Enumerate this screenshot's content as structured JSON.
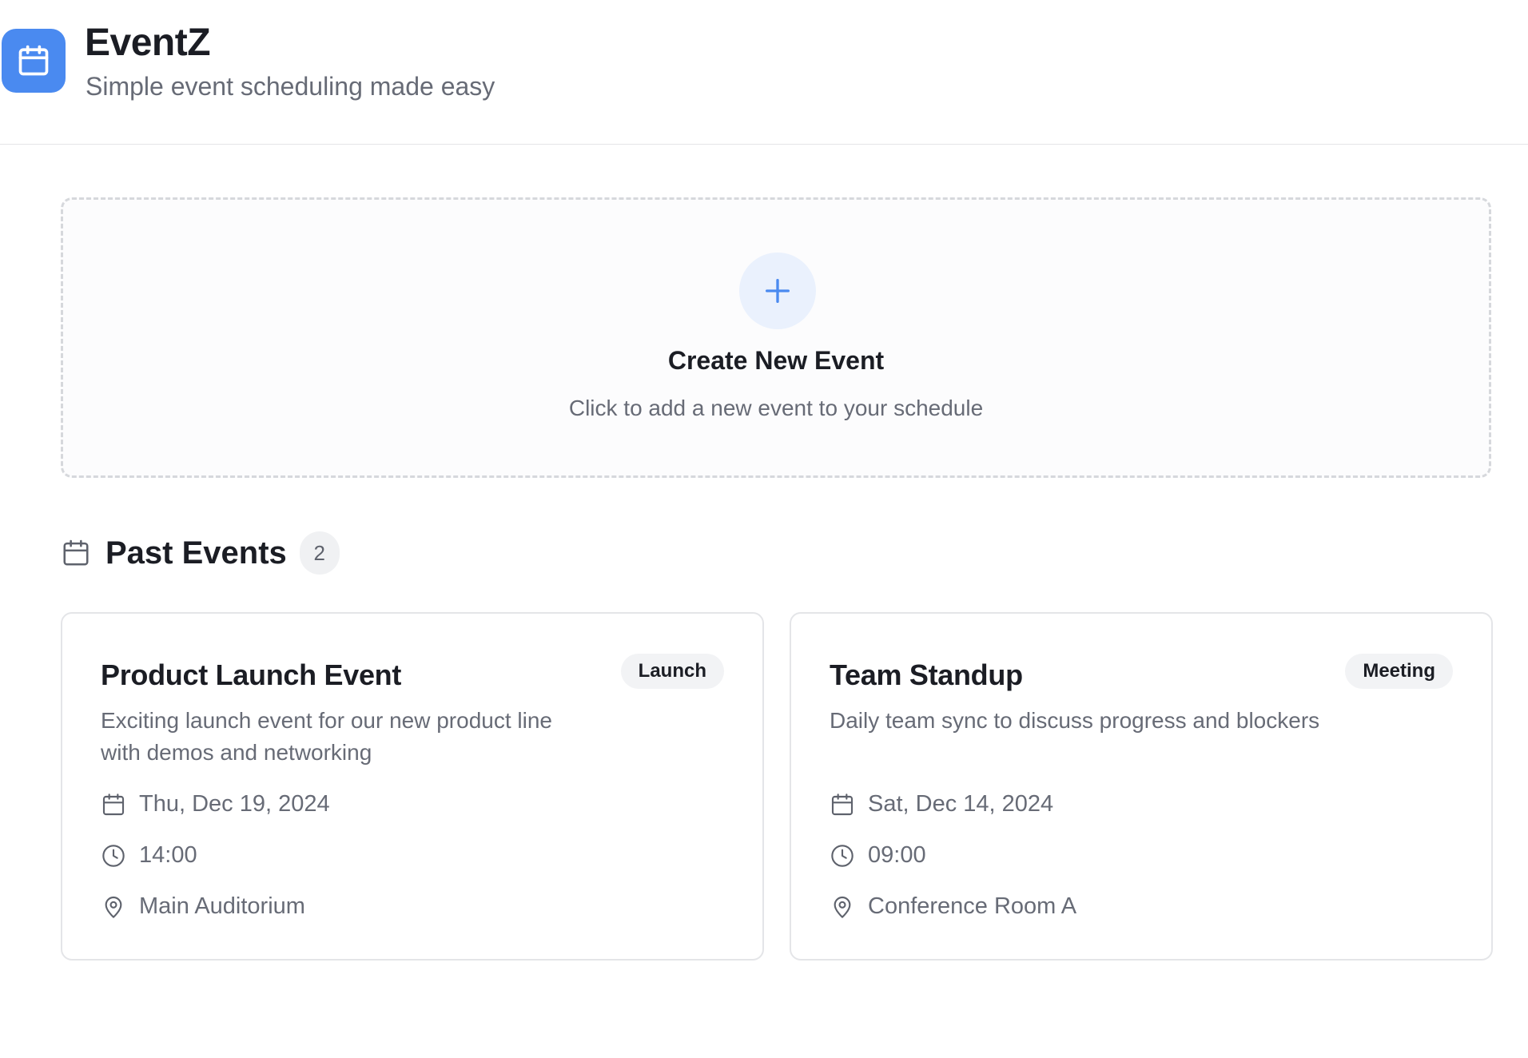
{
  "app": {
    "title": "EventZ",
    "subtitle": "Simple event scheduling made easy",
    "logo_icon": "calendar-icon",
    "accent_color": "#4a8af0"
  },
  "create": {
    "title": "Create New Event",
    "description": "Click to add a new event to your schedule",
    "icon": "plus-icon"
  },
  "past_events": {
    "title": "Past Events",
    "count": "2",
    "icon": "calendar-icon",
    "events": [
      {
        "title": "Product Launch Event",
        "tag": "Launch",
        "description": "Exciting launch event for our new product line with demos and networking",
        "date": "Thu, Dec 19, 2024",
        "time": "14:00",
        "location": "Main Auditorium"
      },
      {
        "title": "Team Standup",
        "tag": "Meeting",
        "description": "Daily team sync to discuss progress and blockers",
        "date": "Sat, Dec 14, 2024",
        "time": "09:00",
        "location": "Conference Room A"
      }
    ]
  }
}
